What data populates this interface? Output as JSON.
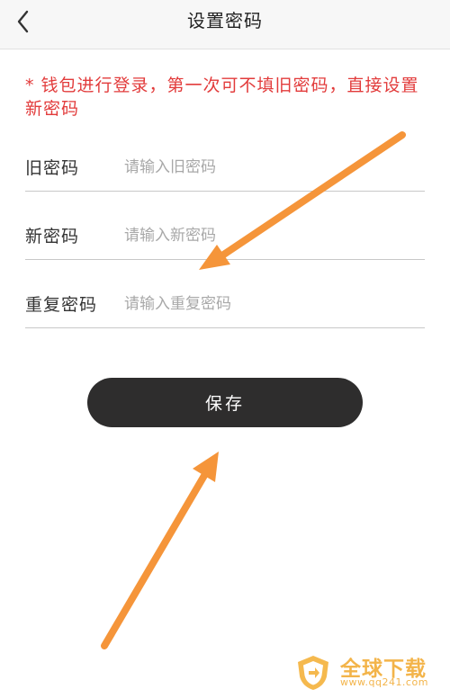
{
  "header": {
    "title": "设置密码",
    "back_icon": "chevron-left-icon"
  },
  "notice": {
    "text": "* 钱包进行登录，第一次可不填旧密码，直接设置新密码",
    "color": "#e23b3b"
  },
  "form": {
    "fields": [
      {
        "label": "旧密码",
        "placeholder": "请输入旧密码",
        "value": ""
      },
      {
        "label": "新密码",
        "placeholder": "请输入新密码",
        "value": ""
      },
      {
        "label": "重复密码",
        "placeholder": "请输入重复密码",
        "value": ""
      }
    ]
  },
  "actions": {
    "save_label": "保存",
    "save_color": "#2e2d2d"
  },
  "annotations": {
    "arrow_color": "#f5953a",
    "arrow_count": 2
  },
  "watermark": {
    "logo_icon": "shield-logo-icon",
    "title": "全球下载",
    "url": "www.qq241.com",
    "color": "#f3b44a"
  }
}
